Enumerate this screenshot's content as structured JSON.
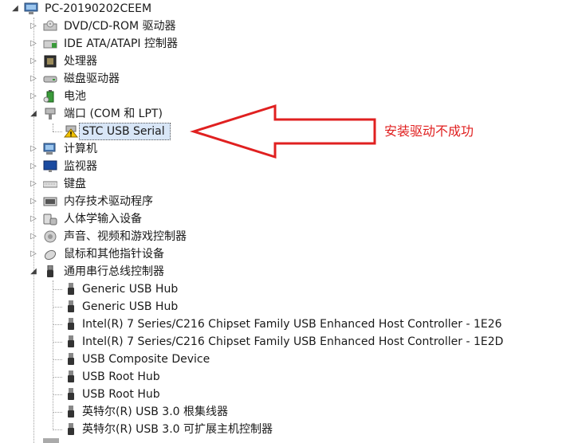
{
  "tree": {
    "root_label": "PC-20190202CEEM",
    "categories": [
      {
        "label": "DVD/CD-ROM 驱动器",
        "icon": "optical-drive-icon",
        "expanded": false
      },
      {
        "label": "IDE ATA/ATAPI 控制器",
        "icon": "ide-controller-icon",
        "expanded": false
      },
      {
        "label": "处理器",
        "icon": "processor-icon",
        "expanded": false
      },
      {
        "label": "磁盘驱动器",
        "icon": "disk-drive-icon",
        "expanded": false
      },
      {
        "label": "电池",
        "icon": "battery-icon",
        "expanded": false
      },
      {
        "label": "端口 (COM 和 LPT)",
        "icon": "port-icon",
        "expanded": true
      },
      {
        "label": "计算机",
        "icon": "computer-icon",
        "expanded": false
      },
      {
        "label": "监视器",
        "icon": "monitor-icon",
        "expanded": false
      },
      {
        "label": "键盘",
        "icon": "keyboard-icon",
        "expanded": false
      },
      {
        "label": "内存技术驱动程序",
        "icon": "memory-icon",
        "expanded": false
      },
      {
        "label": "人体学输入设备",
        "icon": "hid-icon",
        "expanded": false
      },
      {
        "label": "声音、视频和游戏控制器",
        "icon": "sound-icon",
        "expanded": false
      },
      {
        "label": "鼠标和其他指针设备",
        "icon": "mouse-icon",
        "expanded": false
      },
      {
        "label": "通用串行总线控制器",
        "icon": "usb-icon",
        "expanded": true
      }
    ],
    "port_children": [
      {
        "label": "STC USB Serial",
        "icon": "warning-device-icon",
        "selected": true
      }
    ],
    "usb_children": [
      {
        "label": "Generic USB Hub"
      },
      {
        "label": "Generic USB Hub"
      },
      {
        "label": "Intel(R) 7 Series/C216 Chipset Family USB Enhanced Host Controller - 1E26"
      },
      {
        "label": "Intel(R) 7 Series/C216 Chipset Family USB Enhanced Host Controller - 1E2D"
      },
      {
        "label": "USB Composite Device"
      },
      {
        "label": "USB Root Hub"
      },
      {
        "label": "USB Root Hub"
      },
      {
        "label": "英特尔(R) USB 3.0 根集线器"
      },
      {
        "label": "英特尔(R) USB 3.0 可扩展主机控制器"
      }
    ]
  },
  "annotation": {
    "text": "安装驱动不成功",
    "color": "#e02020"
  },
  "colors": {
    "selection": "#d8e6f7",
    "annotation_arrow": "#e02020",
    "warning": "#f2c200"
  }
}
